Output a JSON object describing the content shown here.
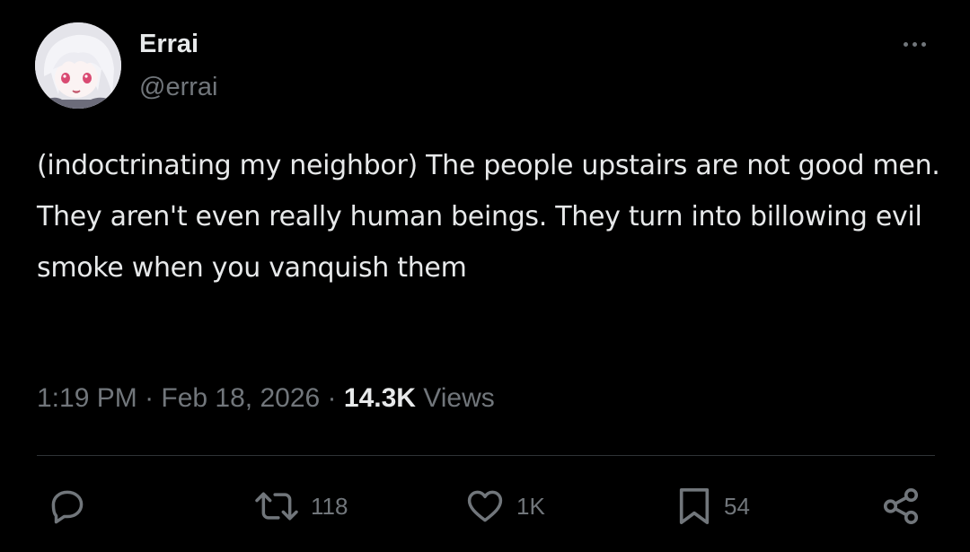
{
  "author": {
    "display_name": "Errai",
    "handle": "@errai",
    "avatar_icon": "anime-avatar"
  },
  "tweet": {
    "text": "(indoctrinating my neighbor) The people upstairs are not good men. They aren't even really human beings. They turn into billowing evil smoke when you vanquish them"
  },
  "meta": {
    "time": "1:19 PM",
    "separator": " · ",
    "date": "Feb 18, 2026",
    "views_count": "14.3K",
    "views_label": " Views"
  },
  "actions": {
    "reply": {
      "icon": "reply-icon",
      "count": ""
    },
    "retweet": {
      "icon": "retweet-icon",
      "count": "118"
    },
    "like": {
      "icon": "heart-icon",
      "count": "1K"
    },
    "bookmark": {
      "icon": "bookmark-icon",
      "count": "54"
    },
    "share": {
      "icon": "share-icon"
    }
  },
  "more_menu": {
    "icon": "more-icon"
  },
  "colors": {
    "background": "#000000",
    "primary_text": "#e7e9ea",
    "secondary_text": "#71767b",
    "divider": "#2f3336"
  }
}
